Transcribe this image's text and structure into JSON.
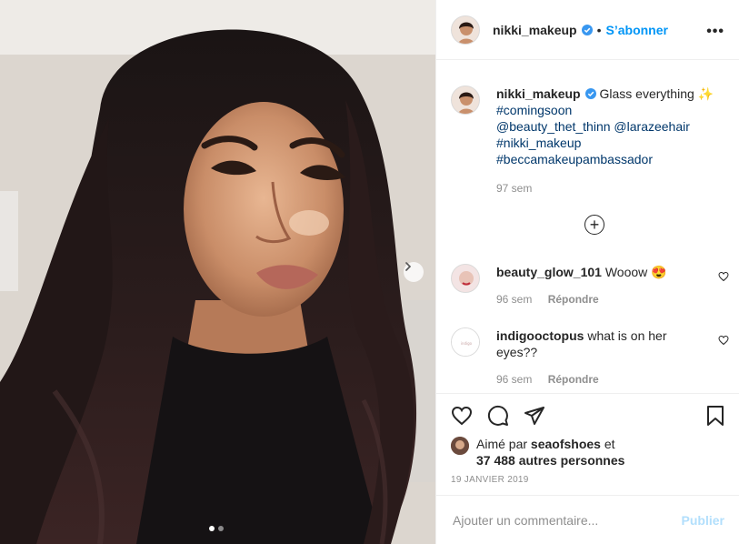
{
  "post": {
    "username": "nikki_makeup",
    "separator": "•",
    "follow_label": "S’abonner",
    "more_label": "•••",
    "caption": {
      "username": "nikki_makeup",
      "text": "Glass everything ✨",
      "tags": [
        "#comingsoon",
        "@beauty_thet_thinn @larazeehair",
        "#nikki_makeup",
        "#beccamakeupambassador"
      ],
      "time": "97 sem"
    },
    "load_more": "+",
    "comments": [
      {
        "username": "beauty_glow_101",
        "text": "Wooow 😍",
        "time": "96 sem",
        "reply": "Répondre"
      },
      {
        "username": "indigooctopus",
        "text": "what is on her eyes??",
        "time": "96 sem",
        "reply": "Répondre"
      }
    ],
    "likes": {
      "prefix": "Aimé par",
      "user": "seaofshoes",
      "and": "et",
      "others": "37 488 autres personnes"
    },
    "date": "19 JANVIER 2019",
    "add_comment": {
      "placeholder": "Ajouter un commentaire...",
      "publish": "Publier"
    }
  },
  "colors": {
    "accent": "#0095f6",
    "link": "#00376b",
    "muted": "#8e8e8e",
    "publish_disabled": "#b2dffc"
  },
  "carousel": {
    "current": 1,
    "total": 2
  }
}
